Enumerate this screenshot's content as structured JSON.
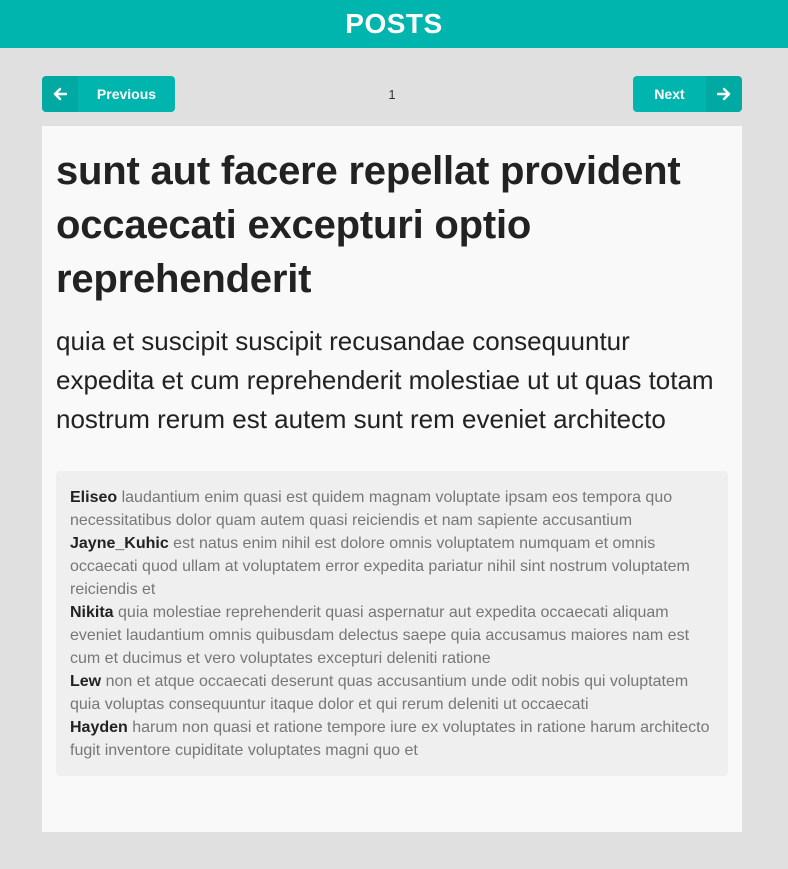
{
  "header": {
    "title": "POSTS",
    "color": "#00b5ad"
  },
  "pagination": {
    "previous_label": "Previous",
    "previous_icon": "arrow-left-icon",
    "next_label": "Next",
    "next_icon": "arrow-right-icon",
    "current_page": "1"
  },
  "post": {
    "title": "sunt aut facere repellat provident occaecati excepturi optio reprehenderit",
    "body": "quia et suscipit suscipit recusandae consequuntur expedita et cum reprehenderit molestiae ut ut quas totam nostrum rerum est autem sunt rem eveniet architecto",
    "comments": [
      {
        "author": "Eliseo",
        "text": "laudantium enim quasi est quidem magnam voluptate ipsam eos tempora quo necessitatibus dolor quam autem quasi reiciendis et nam sapiente accusantium"
      },
      {
        "author": "Jayne_Kuhic",
        "text": "est natus enim nihil est dolore omnis voluptatem numquam et omnis occaecati quod ullam at voluptatem error expedita pariatur nihil sint nostrum voluptatem reiciendis et"
      },
      {
        "author": "Nikita",
        "text": "quia molestiae reprehenderit quasi aspernatur aut expedita occaecati aliquam eveniet laudantium omnis quibusdam delectus saepe quia accusamus maiores nam est cum et ducimus et vero voluptates excepturi deleniti ratione"
      },
      {
        "author": "Lew",
        "text": "non et atque occaecati deserunt quas accusantium unde odit nobis qui voluptatem quia voluptas consequuntur itaque dolor et qui rerum deleniti ut occaecati"
      },
      {
        "author": "Hayden",
        "text": "harum non quasi et ratione tempore iure ex voluptates in ratione harum architecto fugit inventore cupiditate voluptates magni quo et"
      }
    ]
  }
}
